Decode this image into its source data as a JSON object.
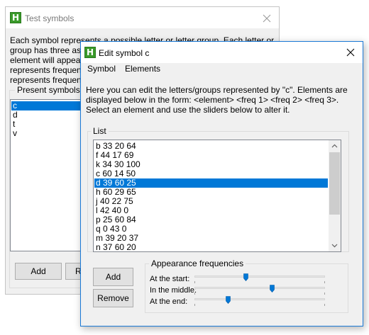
{
  "background_window": {
    "title": "Test symbols",
    "description_lines": [
      "Each symbol represents a possible letter or letter group. Each letter or",
      "group has three asso",
      "element will appear a",
      "represents frequency",
      "represents frequency"
    ],
    "group_title": "Present symbols",
    "symbols": [
      "c",
      "d",
      "t",
      "v"
    ],
    "selected_symbol_index": 0,
    "add_button": "Add",
    "second_button_partial": "Re"
  },
  "dialog": {
    "title": "Edit symbol c",
    "menu": [
      "Symbol",
      "Elements"
    ],
    "instructions": [
      "Here you can edit the letters/groups represented by \"c\". Elements are",
      "displayed below in the form: <element> <freq 1> <freq 2> <freq 3>.",
      "Select an element and use the sliders below to alter it."
    ],
    "list_group_title": "List",
    "elements": [
      "b 33 20 64",
      "f 44 17 69",
      "k 34 30 100",
      "c 60 14 50",
      "d 39 60 25",
      "h 60 29 65",
      "j 40 22 75",
      "l 42 40 0",
      "p 25 60 84",
      "q 0 43 0",
      "m 39 20 37",
      "n 37 60 20"
    ],
    "selected_element_index": 4,
    "add_button": "Add",
    "remove_button": "Remove",
    "freq_group_title": "Appearance frequencies",
    "sliders": [
      {
        "label": "At the start:",
        "value": 39
      },
      {
        "label": "In the middle:",
        "value": 60
      },
      {
        "label": "At the end:",
        "value": 25
      }
    ]
  },
  "colors": {
    "selection": "#0078d7",
    "app_icon": "#3a9a2a",
    "active_border": "#1a79d6"
  },
  "icons": [
    "app-icon",
    "close-icon",
    "scroll-up-icon",
    "scroll-down-icon",
    "slider-thumb-icon"
  ]
}
